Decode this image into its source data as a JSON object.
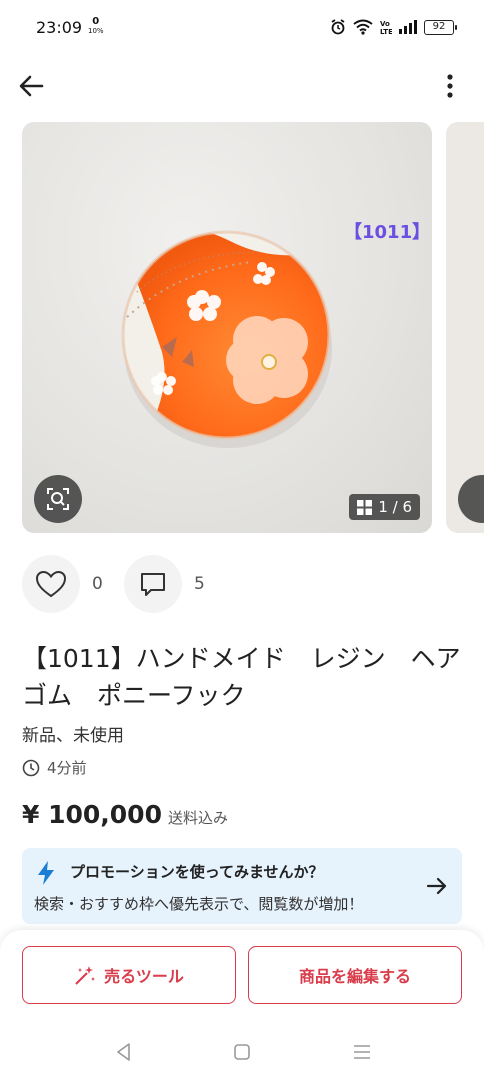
{
  "status": {
    "time": "23:09",
    "net_speed_top": "0",
    "net_speed_unit": "10%",
    "battery": "92"
  },
  "photo": {
    "label": "【1011】",
    "counter": "1 / 6"
  },
  "actions": {
    "likes": "0",
    "comments": "5"
  },
  "item": {
    "title": "【1011】ハンドメイド　レジン　ヘアゴム　ポニーフック",
    "condition": "新品、未使用",
    "posted": "4分前",
    "price": "¥ 100,000",
    "shipping": "送料込み"
  },
  "promo": {
    "title": "プロモーションを使ってみませんか？",
    "description": "検索・おすすめ枠へ優先表示で、閲覧数が増加！"
  },
  "buttons": {
    "sell_tools": "売るツール",
    "edit_item": "商品を編集する"
  },
  "colors": {
    "accent_red": "#d93c4a",
    "promo_bg": "#e6f2fc",
    "promo_icon": "#1a7fd4",
    "label_purple": "#6b4fe0",
    "resin_orange": "#ff6a1a"
  },
  "icons": {
    "back": "arrow-left-icon",
    "more": "more-vertical-icon",
    "lens": "image-search-icon",
    "gallery": "grid-icon",
    "like": "heart-icon",
    "comment": "comment-icon",
    "clock": "clock-icon",
    "promo": "lightning-icon",
    "arrow": "arrow-right-icon",
    "sparkle": "sparkle-wand-icon",
    "nav_back": "triangle-back-icon",
    "nav_home": "square-home-icon",
    "nav_menu": "menu-lines-icon"
  }
}
